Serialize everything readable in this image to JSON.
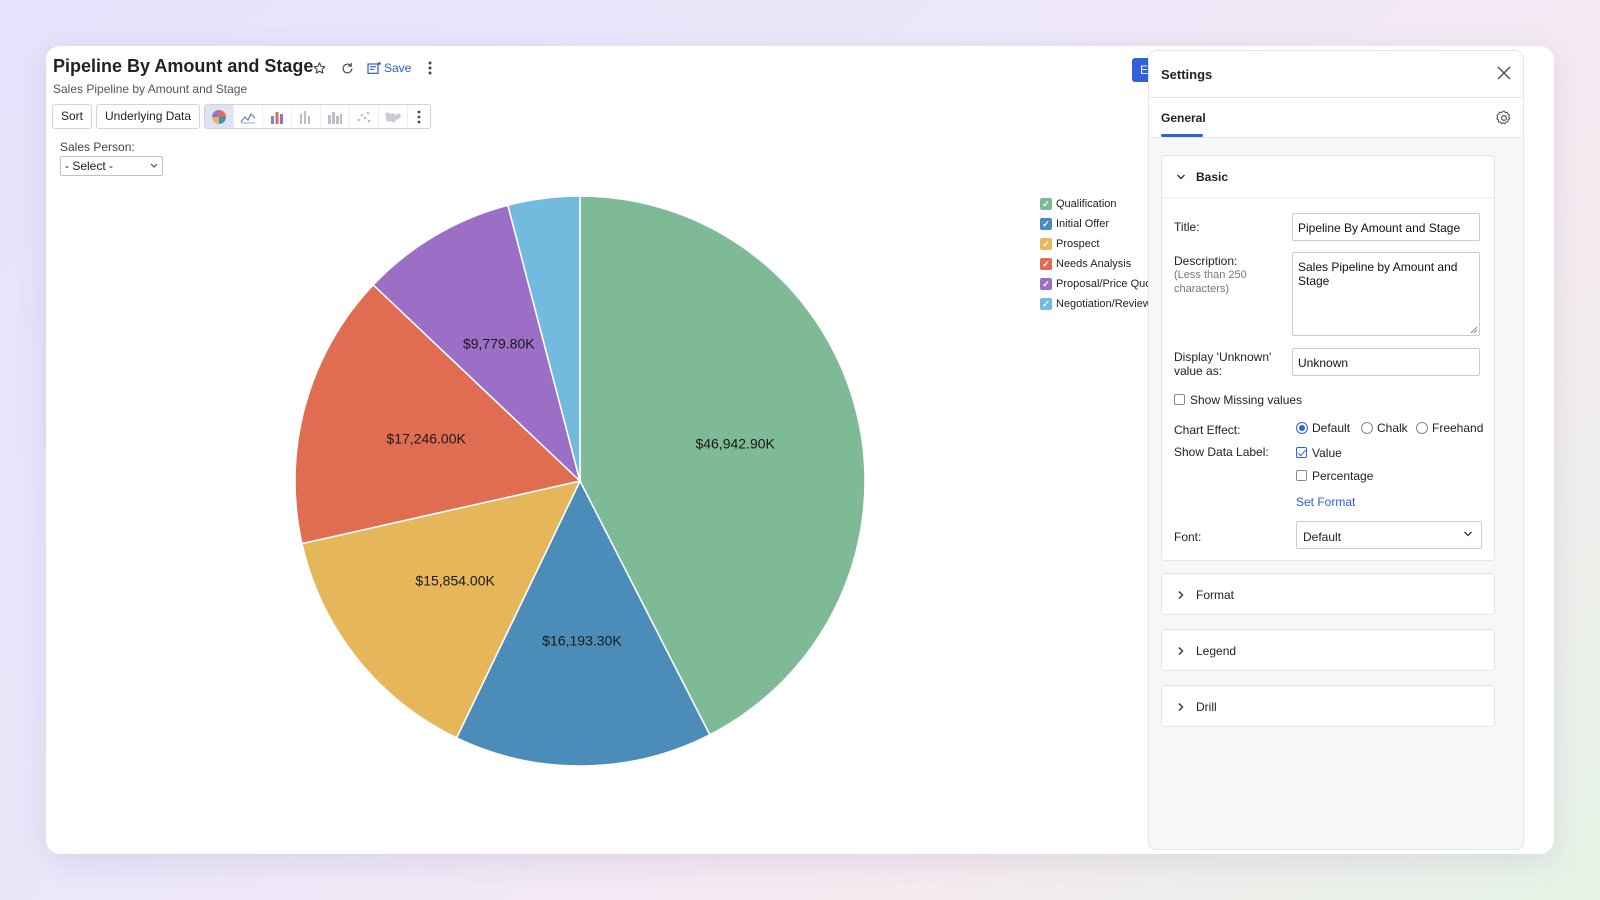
{
  "report": {
    "title": "Pipeline By Amount and Stage",
    "subtitle": "Sales Pipeline by Amount and Stage",
    "save_label": "Save"
  },
  "toolbar": {
    "sort_label": "Sort",
    "underlying_label": "Underlying Data",
    "chart_type_icons": [
      "pie-chart-icon",
      "line-chart-icon",
      "bar-chart-icon",
      "stacked-bar-icon",
      "grouped-bar-icon",
      "scatter-icon",
      "map-icon",
      "more-icon"
    ]
  },
  "filter": {
    "label": "Sales Person:",
    "value": "- Select -"
  },
  "edit_stub": "E",
  "chart_data": {
    "type": "pie",
    "categories": [
      "Qualification",
      "Initial Offer",
      "Prospect",
      "Needs Analysis",
      "Proposal/Price Quote",
      "Negotiation/Review"
    ],
    "values": [
      46942.9,
      16193.3,
      15854.0,
      17246.0,
      9779.8,
      4500
    ],
    "labels": [
      "$46,942.90K",
      "$16,193.30K",
      "$15,854.00K",
      "$17,246.00K",
      "$9,779.80K",
      ""
    ],
    "colors": [
      "#7fba97",
      "#4b8db8",
      "#e6b75a",
      "#e06d52",
      "#9b6fc5",
      "#72bade"
    ],
    "legend_position": "top-right"
  },
  "settings": {
    "title": "Settings",
    "tab": "General",
    "basic": {
      "header": "Basic",
      "title_label": "Title:",
      "title_value": "Pipeline By Amount and Stage",
      "description_label": "Description:",
      "description_hint_1": "(Less than 250",
      "description_hint_2": "characters)",
      "description_value": "Sales Pipeline by Amount and Stage",
      "unknown_label_1": "Display 'Unknown'",
      "unknown_label_2": "value as:",
      "unknown_value": "Unknown",
      "show_missing_label": "Show Missing values",
      "chart_effect_label": "Chart Effect:",
      "chart_effect_options": [
        "Default",
        "Chalk",
        "Freehand"
      ],
      "show_data_label_label": "Show Data Label:",
      "data_label_value": "Value",
      "data_label_percentage": "Percentage",
      "set_format_link": "Set Format",
      "font_label": "Font:",
      "font_value": "Default"
    },
    "sections": [
      "Format",
      "Legend",
      "Drill"
    ]
  }
}
